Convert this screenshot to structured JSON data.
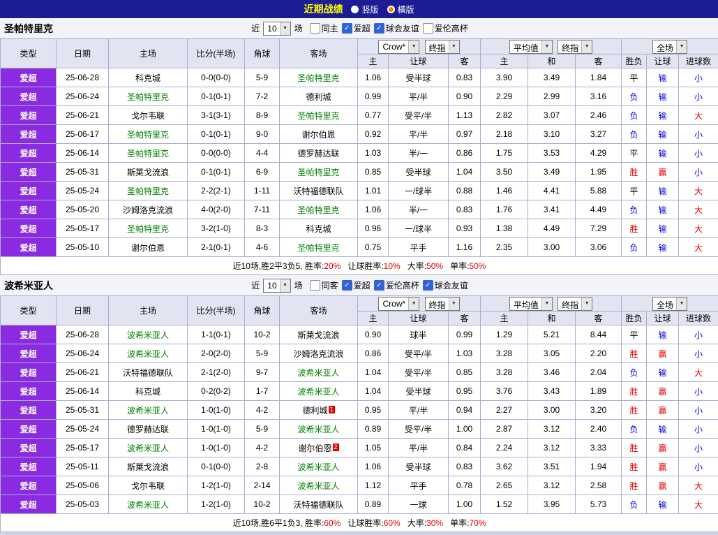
{
  "topbar": {
    "title": "近期战绩",
    "radios": [
      {
        "label": "竖版",
        "selected": false
      },
      {
        "label": "横版",
        "selected": true
      }
    ]
  },
  "filter_labels": {
    "near": "近",
    "matches": "场"
  },
  "table_header": {
    "main_cols": [
      "类型",
      "日期",
      "主场",
      "比分(半场)",
      "角球",
      "客场"
    ],
    "sub_cols": [
      "主",
      "让球",
      "客",
      "主",
      "和",
      "客",
      "胜负",
      "让球",
      "进球数"
    ],
    "selects": {
      "asian": [
        "Crow*",
        "终指"
      ],
      "euro": [
        "平均值",
        "终指"
      ],
      "result": [
        "全场"
      ]
    }
  },
  "colors": {
    "topbar_bg": "#1c1c94",
    "title_text": "#ffff00",
    "type_badge": "#8a2be2",
    "team_highlight": "#008000",
    "win_red": "#e10000",
    "loss_blue": "#0000e0"
  },
  "sections": [
    {
      "team": "圣帕特里克",
      "filter": {
        "count": "10",
        "items": [
          {
            "label": "同主",
            "checked": false
          },
          {
            "label": "爱超",
            "checked": true
          },
          {
            "label": "球会友谊",
            "checked": true
          },
          {
            "label": "爱伦高杯",
            "checked": false
          }
        ]
      },
      "rows": [
        {
          "type": "爱超",
          "date": "25-06-28",
          "home": "科克城",
          "score": "0-0(0-0)",
          "corners": "5-9",
          "away": "圣帕特里克",
          "away_hl": true,
          "a_home": "1.06",
          "handicap": "受半球",
          "a_away": "0.83",
          "e_home": "3.90",
          "e_draw": "3.49",
          "e_away": "1.84",
          "result": "平",
          "handicap_result": "输",
          "goals": "小"
        },
        {
          "type": "爱超",
          "date": "25-06-24",
          "home": "圣帕特里克",
          "home_hl": true,
          "score": "0-1(0-1)",
          "corners": "7-2",
          "away": "德利城",
          "a_home": "0.99",
          "handicap": "平/半",
          "a_away": "0.90",
          "e_home": "2.29",
          "e_draw": "2.99",
          "e_away": "3.16",
          "result": "负",
          "handicap_result": "输",
          "goals": "小"
        },
        {
          "type": "爱超",
          "date": "25-06-21",
          "home": "戈尔韦联",
          "score": "3-1(3-1)",
          "corners": "8-9",
          "away": "圣帕特里克",
          "away_hl": true,
          "a_home": "0.77",
          "handicap": "受平/半",
          "a_away": "1.13",
          "e_home": "2.82",
          "e_draw": "3.07",
          "e_away": "2.46",
          "result": "负",
          "handicap_result": "输",
          "goals": "大"
        },
        {
          "type": "爱超",
          "date": "25-06-17",
          "home": "圣帕特里克",
          "home_hl": true,
          "score": "0-1(0-1)",
          "corners": "9-0",
          "away": "谢尔伯恩",
          "a_home": "0.92",
          "handicap": "平/半",
          "a_away": "0.97",
          "e_home": "2.18",
          "e_draw": "3.10",
          "e_away": "3.27",
          "result": "负",
          "handicap_result": "输",
          "goals": "小"
        },
        {
          "type": "爱超",
          "date": "25-06-14",
          "home": "圣帕特里克",
          "home_hl": true,
          "score": "0-0(0-0)",
          "corners": "4-4",
          "away": "德罗赫达联",
          "a_home": "1.03",
          "handicap": "半/一",
          "a_away": "0.86",
          "e_home": "1.75",
          "e_draw": "3.53",
          "e_away": "4.29",
          "result": "平",
          "handicap_result": "输",
          "goals": "小"
        },
        {
          "type": "爱超",
          "date": "25-05-31",
          "home": "斯莱戈流浪",
          "score": "0-1(0-1)",
          "corners": "6-9",
          "away": "圣帕特里克",
          "away_hl": true,
          "a_home": "0.85",
          "handicap": "受半球",
          "a_away": "1.04",
          "e_home": "3.50",
          "e_draw": "3.49",
          "e_away": "1.95",
          "result": "胜",
          "handicap_result": "赢",
          "goals": "小"
        },
        {
          "type": "爱超",
          "date": "25-05-24",
          "home": "圣帕特里克",
          "home_hl": true,
          "score": "2-2(2-1)",
          "corners": "1-11",
          "away": "沃特福德联队",
          "a_home": "1.01",
          "handicap": "一/球半",
          "a_away": "0.88",
          "e_home": "1.46",
          "e_draw": "4.41",
          "e_away": "5.88",
          "result": "平",
          "handicap_result": "输",
          "goals": "大"
        },
        {
          "type": "爱超",
          "date": "25-05-20",
          "home": "沙姆洛克流浪",
          "score": "4-0(2-0)",
          "corners": "7-11",
          "away": "圣帕特里克",
          "away_hl": true,
          "a_home": "1.06",
          "handicap": "半/一",
          "a_away": "0.83",
          "e_home": "1.76",
          "e_draw": "3.41",
          "e_away": "4.49",
          "result": "负",
          "handicap_result": "输",
          "goals": "大"
        },
        {
          "type": "爱超",
          "date": "25-05-17",
          "home": "圣帕特里克",
          "home_hl": true,
          "score": "3-2(1-0)",
          "corners": "8-3",
          "away": "科克城",
          "a_home": "0.96",
          "handicap": "一/球半",
          "a_away": "0.93",
          "e_home": "1.38",
          "e_draw": "4.49",
          "e_away": "7.29",
          "result": "胜",
          "handicap_result": "输",
          "goals": "大"
        },
        {
          "type": "爱超",
          "date": "25-05-10",
          "home": "谢尔伯恩",
          "score": "2-1(0-1)",
          "corners": "4-6",
          "away": "圣帕特里克",
          "away_hl": true,
          "a_home": "0.75",
          "handicap": "平手",
          "a_away": "1.16",
          "e_home": "2.35",
          "e_draw": "3.00",
          "e_away": "3.06",
          "result": "负",
          "handicap_result": "输",
          "goals": "大"
        }
      ],
      "summary": [
        {
          "text": "近10场,胜2平3负5, 胜率:",
          "red": false
        },
        {
          "text": "20%",
          "red": true
        },
        {
          "text": "让球胜率:",
          "red": false
        },
        {
          "text": "10%",
          "red": true
        },
        {
          "text": "大率:",
          "red": false
        },
        {
          "text": "50%",
          "red": true
        },
        {
          "text": "单率:",
          "red": false
        },
        {
          "text": "50%",
          "red": true
        }
      ]
    },
    {
      "team": "波希米亚人",
      "filter": {
        "count": "10",
        "items": [
          {
            "label": "同客",
            "checked": false
          },
          {
            "label": "爱超",
            "checked": true
          },
          {
            "label": "爱伦高杯",
            "checked": true
          },
          {
            "label": "球会友谊",
            "checked": true
          }
        ]
      },
      "rows": [
        {
          "type": "爱超",
          "date": "25-06-28",
          "home": "波希米亚人",
          "home_hl": true,
          "score": "1-1(0-1)",
          "corners": "10-2",
          "away": "斯莱戈流浪",
          "a_home": "0.90",
          "handicap": "球半",
          "a_away": "0.99",
          "e_home": "1.29",
          "e_draw": "5.21",
          "e_away": "8.44",
          "result": "平",
          "handicap_result": "输",
          "goals": "小"
        },
        {
          "type": "爱超",
          "date": "25-06-24",
          "home": "波希米亚人",
          "home_hl": true,
          "score": "2-0(2-0)",
          "corners": "5-9",
          "away": "沙姆洛克流浪",
          "a_home": "0.86",
          "handicap": "受平/半",
          "a_away": "1.03",
          "e_home": "3.28",
          "e_draw": "3.05",
          "e_away": "2.20",
          "result": "胜",
          "handicap_result": "赢",
          "goals": "小"
        },
        {
          "type": "爱超",
          "date": "25-06-21",
          "home": "沃特福德联队",
          "score": "2-1(2-0)",
          "corners": "9-7",
          "away": "波希米亚人",
          "away_hl": true,
          "a_home": "1.04",
          "handicap": "受平/半",
          "a_away": "0.85",
          "e_home": "3.28",
          "e_draw": "3.46",
          "e_away": "2.04",
          "result": "负",
          "handicap_result": "输",
          "goals": "大"
        },
        {
          "type": "爱超",
          "date": "25-06-14",
          "home": "科克城",
          "score": "0-2(0-2)",
          "corners": "1-7",
          "away": "波希米亚人",
          "away_hl": true,
          "a_home": "1.04",
          "handicap": "受半球",
          "a_away": "0.95",
          "e_home": "3.76",
          "e_draw": "3.43",
          "e_away": "1.89",
          "result": "胜",
          "handicap_result": "赢",
          "goals": "小"
        },
        {
          "type": "爱超",
          "date": "25-05-31",
          "home": "波希米亚人",
          "home_hl": true,
          "score": "1-0(1-0)",
          "corners": "4-2",
          "away": "德利城",
          "away_badge": "1",
          "a_home": "0.95",
          "handicap": "平/半",
          "a_away": "0.94",
          "e_home": "2.27",
          "e_draw": "3.00",
          "e_away": "3.20",
          "result": "胜",
          "handicap_result": "赢",
          "goals": "小"
        },
        {
          "type": "爱超",
          "date": "25-05-24",
          "home": "德罗赫达联",
          "score": "1-0(1-0)",
          "corners": "5-9",
          "away": "波希米亚人",
          "away_hl": true,
          "a_home": "0.89",
          "handicap": "受平/半",
          "a_away": "1.00",
          "e_home": "2.87",
          "e_draw": "3.12",
          "e_away": "2.40",
          "result": "负",
          "handicap_result": "输",
          "goals": "小"
        },
        {
          "type": "爱超",
          "date": "25-05-17",
          "home": "波希米亚人",
          "home_hl": true,
          "score": "1-0(1-0)",
          "corners": "4-2",
          "away": "谢尔伯恩",
          "away_badge": "2",
          "a_home": "1.05",
          "handicap": "平/半",
          "a_away": "0.84",
          "e_home": "2.24",
          "e_draw": "3.12",
          "e_away": "3.33",
          "result": "胜",
          "handicap_result": "赢",
          "goals": "小"
        },
        {
          "type": "爱超",
          "date": "25-05-11",
          "home": "斯莱戈流浪",
          "score": "0-1(0-0)",
          "corners": "2-8",
          "away": "波希米亚人",
          "away_hl": true,
          "a_home": "1.06",
          "handicap": "受半球",
          "a_away": "0.83",
          "e_home": "3.62",
          "e_draw": "3.51",
          "e_away": "1.94",
          "result": "胜",
          "handicap_result": "赢",
          "goals": "小"
        },
        {
          "type": "爱超",
          "date": "25-05-06",
          "home": "戈尔韦联",
          "score": "1-2(1-0)",
          "corners": "2-14",
          "away": "波希米亚人",
          "away_hl": true,
          "a_home": "1.12",
          "handicap": "平手",
          "a_away": "0.78",
          "e_home": "2.65",
          "e_draw": "3.12",
          "e_away": "2.58",
          "result": "胜",
          "handicap_result": "赢",
          "goals": "大"
        },
        {
          "type": "爱超",
          "date": "25-05-03",
          "home": "波希米亚人",
          "home_hl": true,
          "score": "1-2(1-0)",
          "corners": "10-2",
          "away": "沃特福德联队",
          "a_home": "0.89",
          "handicap": "一球",
          "a_away": "1.00",
          "e_home": "1.52",
          "e_draw": "3.95",
          "e_away": "5.73",
          "result": "负",
          "handicap_result": "输",
          "goals": "大"
        }
      ],
      "summary": [
        {
          "text": "近10场,胜6平1负3, 胜率:",
          "red": false
        },
        {
          "text": "60%",
          "red": true
        },
        {
          "text": "让球胜率:",
          "red": false
        },
        {
          "text": "60%",
          "red": true
        },
        {
          "text": "大率:",
          "red": false
        },
        {
          "text": "30%",
          "red": true
        },
        {
          "text": "单率:",
          "red": false
        },
        {
          "text": "70%",
          "red": true
        }
      ]
    }
  ]
}
